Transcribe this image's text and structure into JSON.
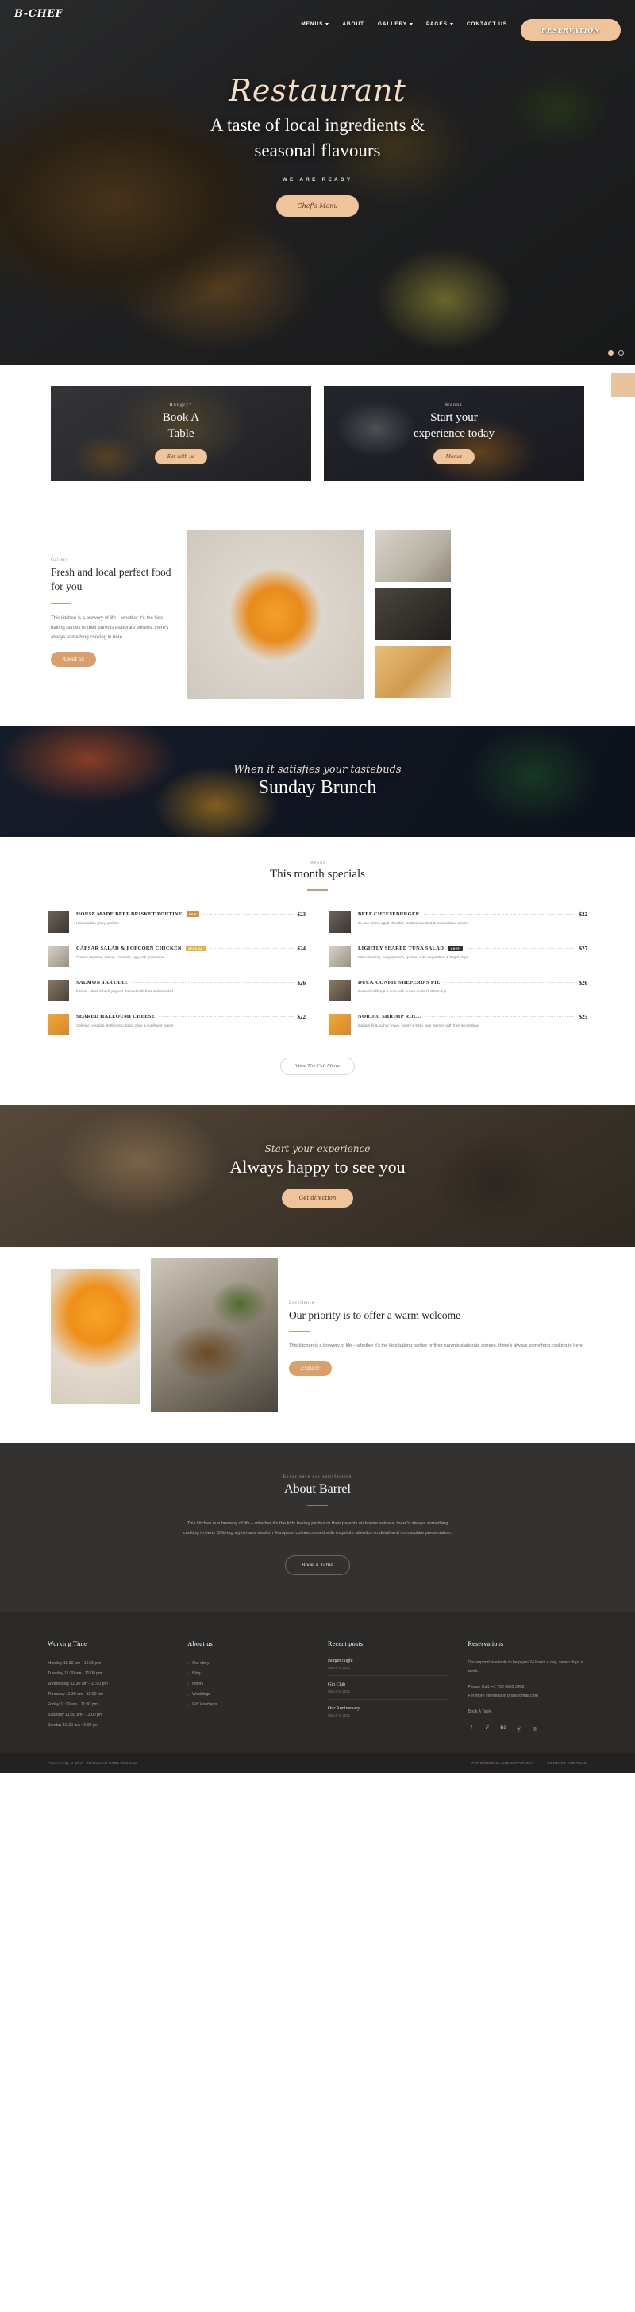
{
  "brand": "B-CHEF",
  "nav": {
    "items": [
      {
        "label": "MENUS",
        "has_dropdown": true
      },
      {
        "label": "ABOUT",
        "has_dropdown": false
      },
      {
        "label": "GALLERY",
        "has_dropdown": true
      },
      {
        "label": "PAGES",
        "has_dropdown": true
      },
      {
        "label": "CONTACT US",
        "has_dropdown": false
      }
    ],
    "cta": "RESERVATION"
  },
  "hero": {
    "script_title": "Restaurant",
    "headline_line1": "A taste of local ingredients &",
    "headline_line2": "seasonal flavours",
    "kicker": "WE ARE READY",
    "button": "Chef's Menu"
  },
  "cards": [
    {
      "label": "Hungry?",
      "title_line1": "Book A",
      "title_line2": "Table",
      "button": "Eat with us"
    },
    {
      "label": "Menus",
      "title_line1": "Start your",
      "title_line2": "experience today",
      "button": "Menus"
    }
  ],
  "fresh": {
    "label": "Gallery",
    "title": "Fresh and local perfect food for you",
    "body": "This kitchen is a brewery of life – whether it's the kids baking parties or their parents elaborate soirees, there's always something cooking in here.",
    "button": "About us"
  },
  "brunch": {
    "kicker": "When it satisfies your tastebuds",
    "title": "Sunday Brunch"
  },
  "specials": {
    "label": "Menus",
    "title": "This month specials",
    "view_button": "View The Full Menu",
    "badge_colors": {
      "new": "#d9913f",
      "special": "#e8b33c",
      "chef": "#2f2f2f"
    },
    "left_items": [
      {
        "name": "HOUSE MADE BEEF BRISKET POUTINE",
        "badge": "NEW",
        "badge_type": "new",
        "price": "$23",
        "desc": "Horseradish gravy, pickles"
      },
      {
        "name": "CAESAR SALAD & POPCORN CHICKEN",
        "badge": "SPECIAL",
        "badge_type": "special",
        "price": "$24",
        "desc": "Classic dressing, bacon, croutons, egg yolk, parmesan"
      },
      {
        "name": "SALMON TARTARE",
        "badge": "",
        "badge_type": "",
        "price": "$26",
        "desc": "Fennel, citrus & herb yogourt. Served with fries and/or salad"
      },
      {
        "name": "SEARED HALLOUMI CHEESE",
        "badge": "",
        "badge_type": "",
        "price": "$22",
        "desc": "Celeriac, veggies, herb pesto, black olive & sunflower seeds"
      }
    ],
    "right_items": [
      {
        "name": "BEEF CHEESEBURGER",
        "badge": "",
        "badge_type": "",
        "price": "$22",
        "desc": "Ile-aux-Grues aged cheddar, smoked mustard & caramelized onions"
      },
      {
        "name": "LIGHTLY SEARED TUNA SALAD",
        "badge": "CHEF",
        "badge_type": "chef",
        "price": "$27",
        "desc": "Miso dressing, baby spinach, quinoa, crisp vegetables & bagel chips"
      },
      {
        "name": "DUCK CONFIT SHEPERD'S PIE",
        "badge": "",
        "badge_type": "",
        "price": "$26",
        "desc": "Braised cabbage & corn with house made fruit ketchup"
      },
      {
        "name": "NORDIC SHRIMP ROLL",
        "badge": "",
        "badge_type": "",
        "price": "$25",
        "desc": "Balsam fir & sumac mayo, celery & baby kale. Served with fries & coleslaw"
      }
    ]
  },
  "happy": {
    "kicker": "Start your experience",
    "title": "Always happy to see you",
    "button": "Get direction"
  },
  "priority": {
    "label": "Excellence",
    "title": "Our priority is to offer a warm welcome",
    "body": "This kitchen is a brewery of life – whether it's the kids baking parties or their parents elaborate soirees, there's always something cooking in here.",
    "button": "Explore"
  },
  "about": {
    "label": "Experience our satisfaction",
    "title": "About Barrel",
    "body": "This kitchen is a brewery of life – whether it's the kids baking parties or their parents elaborate soirees, there's always something cooking in here. Offering stylish and modern European cuisine served with exquisite attention to detail and immaculate presentation.",
    "button": "Book A Table"
  },
  "footer": {
    "working_time": {
      "title": "Working Time",
      "rows": [
        "Monday 11:30 am - 10:00 pm",
        "Tuesday 11:30 am - 11:00 pm",
        "Wednesday 11:30 am - 11:00 pm",
        "Thursday 11:30 am - 11:00 pm",
        "Friday 11:30 am - 11:00 pm",
        "Saturday 11:30 am - 11:00 pm",
        "Sunday 10:30 am - 9:00 pm"
      ]
    },
    "about_us": {
      "title": "About us",
      "links": [
        "Our story",
        "Blog",
        "Offers",
        "Weddings",
        "Gift Vouchers"
      ]
    },
    "recent_posts": {
      "title": "Recent posts",
      "posts": [
        {
          "title": "Burger Night",
          "date": "March 5, 2021"
        },
        {
          "title": "Gin Club",
          "date": "March 5, 2021"
        },
        {
          "title": "Our Anniversary",
          "date": "March 5, 2021"
        }
      ]
    },
    "reservations": {
      "title": "Reservations",
      "support": "Our support available to help you 24 hours a day, seven days a week.",
      "phone": "Please Call: +1 703 4959 3452",
      "email": "For more information bnst@gmail.com",
      "book": "Book A Table",
      "socials": [
        "facebook-icon",
        "twitter-icon",
        "behance-icon",
        "pinterest-icon",
        "instagram-icon"
      ],
      "social_glyphs": [
        "f",
        "𝑭",
        "Bē",
        "ⓟ",
        "◎"
      ]
    }
  },
  "copyright": {
    "left": "Powered by B-Chef - Restaurant HTML Template",
    "links": [
      "PERMISSIONS AND COPYRIGHT",
      "CONTACT THE TEAM"
    ]
  }
}
